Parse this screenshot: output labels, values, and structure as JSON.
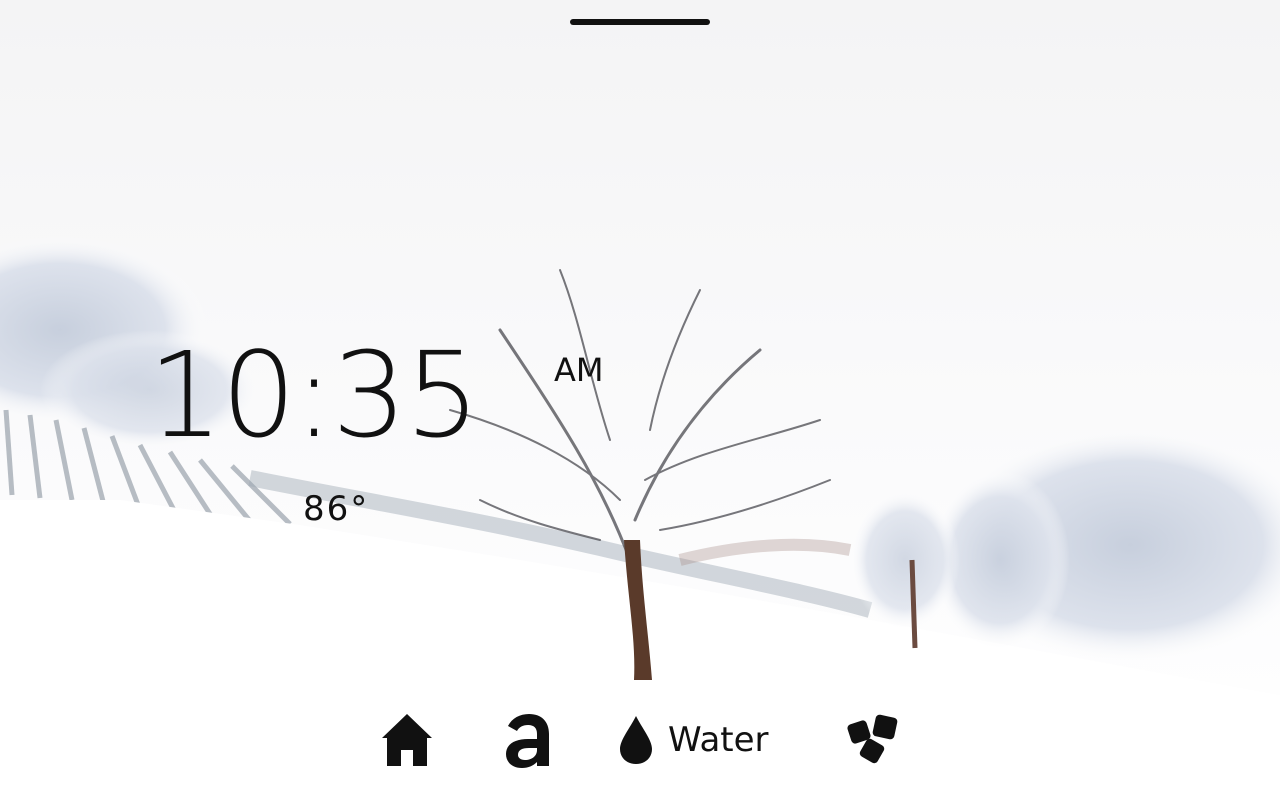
{
  "clock": {
    "time": "10:35",
    "ampm": "AM"
  },
  "weather": {
    "temperature": "86°"
  },
  "dock": {
    "items": [
      {
        "icon": "home-icon",
        "label": ""
      },
      {
        "icon": "amazon-a-icon",
        "label": ""
      },
      {
        "icon": "water-drop-icon",
        "label": "Water"
      },
      {
        "icon": "tiles-icon",
        "label": ""
      }
    ]
  },
  "colors": {
    "foreground": "#111111",
    "background": "#ffffff",
    "trunk": "#5a3a2a"
  }
}
